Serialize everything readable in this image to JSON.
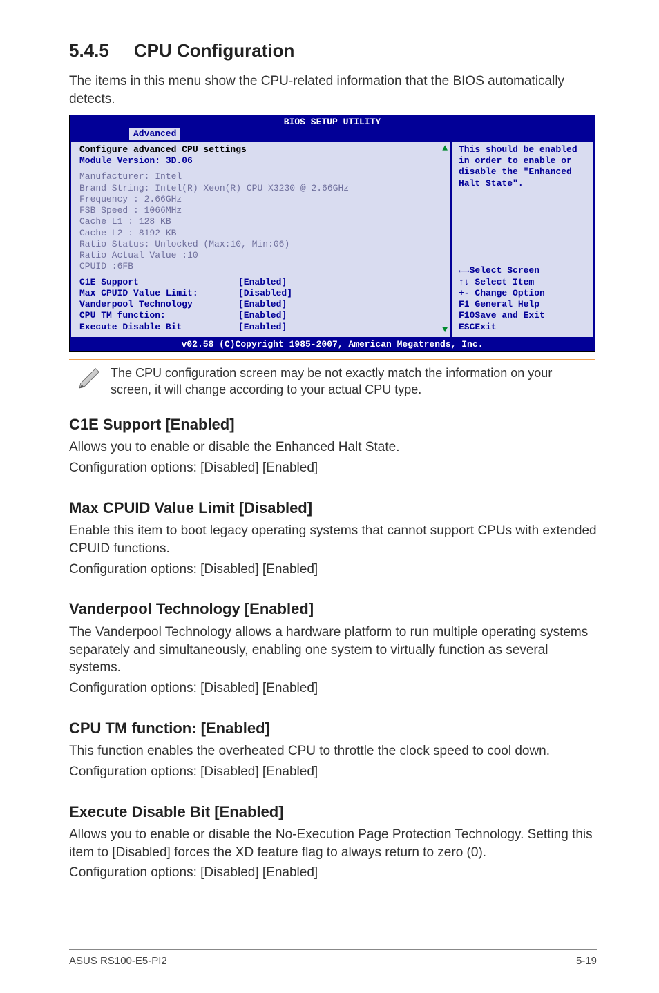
{
  "section": {
    "number": "5.4.5",
    "title": "CPU Configuration"
  },
  "lead": "The items in this menu show the CPU-related information that the BIOS automatically detects.",
  "bios": {
    "title": "BIOS SETUP UTILITY",
    "tab": "Advanced",
    "header1": "Configure advanced CPU settings",
    "header2": "Module Version: 3D.06",
    "info": {
      "l1": "Manufacturer: Intel",
      "l2": "Brand String: Intel(R) Xeon(R) CPU X3230 @ 2.66GHz",
      "l3": "Frequency   : 2.66GHz",
      "l4": "FSB Speed   : 1066MHz",
      "l5": "Cache L1    : 128 KB",
      "l6": "Cache L2    : 8192 KB",
      "l7": "Ratio Status: Unlocked (Max:10, Min:06)",
      "l8": "Ratio Actual Value  :10",
      "l9": "CPUID       :6FB"
    },
    "options": [
      {
        "label": "C1E Support",
        "value": "[Enabled]"
      },
      {
        "label": "Max CPUID Value Limit:",
        "value": "[Disabled]"
      },
      {
        "label": "Vanderpool Technology",
        "value": "[Enabled]"
      },
      {
        "label": "CPU TM function:",
        "value": "[Enabled]"
      },
      {
        "label": "Execute Disable Bit",
        "value": "[Enabled]"
      }
    ],
    "help": "This should be enabled in order to enable or disable the \"Enhanced Halt State\".",
    "keys": {
      "k1": "←→Select Screen",
      "k2": "↑↓ Select Item",
      "k3": "+- Change Option",
      "k4": "F1 General Help",
      "k5": "F10Save and Exit",
      "k6": "ESCExit"
    },
    "footer": "v02.58 (C)Copyright 1985-2007, American Megatrends, Inc."
  },
  "note": "The CPU configuration screen may be not exactly match the information on your screen, it will change according to your actual CPU type.",
  "subsections": {
    "c1e": {
      "title": "C1E Support [Enabled]",
      "p1": "Allows you to enable or disable the Enhanced Halt State.",
      "p2": "Configuration options: [Disabled] [Enabled]"
    },
    "max": {
      "title": "Max CPUID Value Limit [Disabled]",
      "p1": "Enable this item to boot legacy operating systems that cannot support CPUs with extended CPUID functions.",
      "p2": "Configuration options: [Disabled] [Enabled]"
    },
    "vander": {
      "title": "Vanderpool Technology [Enabled]",
      "p1": "The Vanderpool Technology allows a hardware platform to run multiple operating systems separately and simultaneously, enabling one system to virtually function as several systems.",
      "p2": "Configuration options: [Disabled] [Enabled]"
    },
    "tm": {
      "title": "CPU TM function: [Enabled]",
      "p1": "This function enables the overheated CPU to throttle the clock speed to cool down.",
      "p2": "Configuration options: [Disabled] [Enabled]"
    },
    "xd": {
      "title": "Execute Disable Bit [Enabled]",
      "p1": "Allows you to enable or disable the No-Execution Page Protection Technology. Setting this item to [Disabled] forces the XD feature flag to always return to zero (0).",
      "p2": "Configuration options: [Disabled] [Enabled]"
    }
  },
  "footer": {
    "left": "ASUS RS100-E5-PI2",
    "right": "5-19"
  }
}
